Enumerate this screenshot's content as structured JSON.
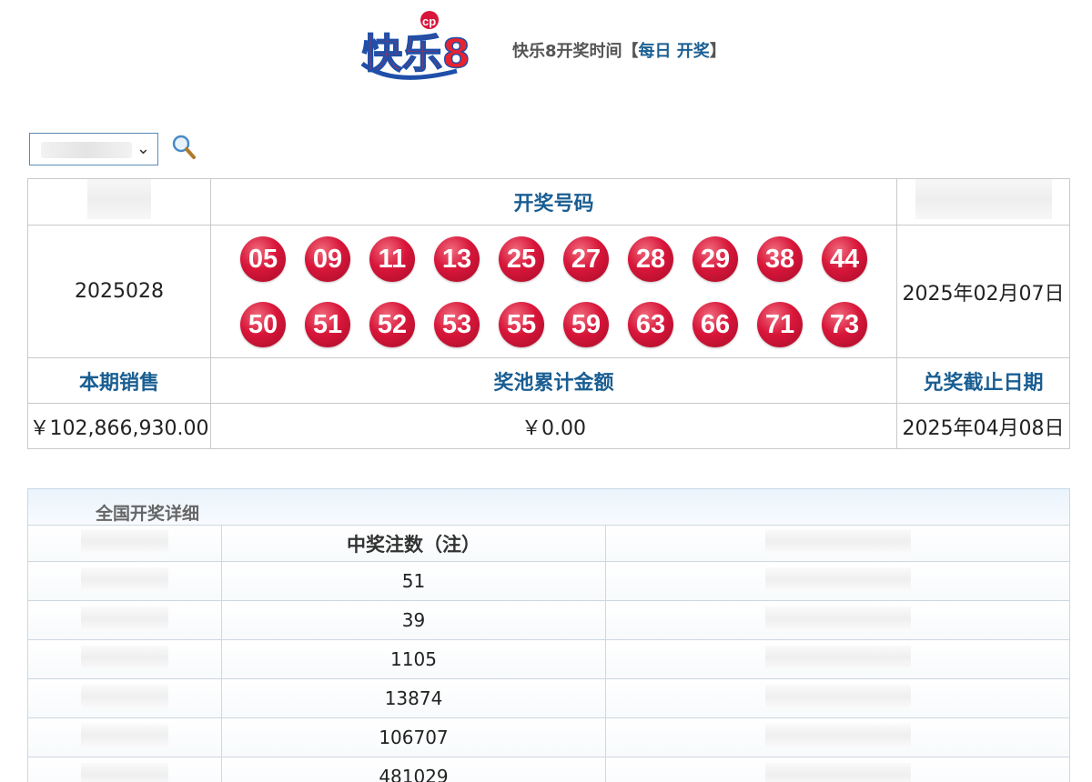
{
  "header": {
    "logo_text": "快乐8",
    "draw_time_label": "快乐8开奖时间【",
    "draw_time_value": "每日 开奖",
    "draw_time_close": "】"
  },
  "selector": {
    "search_icon": "magnifier-icon"
  },
  "results": {
    "draw_numbers_header": "开奖号码",
    "issue": "2025028",
    "numbers": [
      "05",
      "09",
      "11",
      "13",
      "25",
      "27",
      "28",
      "29",
      "38",
      "44",
      "50",
      "51",
      "52",
      "53",
      "55",
      "59",
      "63",
      "66",
      "71",
      "73"
    ],
    "draw_date": "2025年02月07日",
    "sales_header": "本期销售",
    "pool_header": "奖池累计金额",
    "deadline_header": "兑奖截止日期",
    "sales_value": "￥102,866,930.00",
    "pool_value": "￥0.00",
    "deadline_value": "2025年04月08日"
  },
  "details": {
    "caption": "全国开奖详细",
    "winners_header": "中奖注数（注）",
    "winner_counts": [
      "51",
      "39",
      "1105",
      "13874",
      "106707",
      "481029"
    ]
  },
  "colors": {
    "ball": "#d8163a",
    "header_text": "#1a5e92"
  }
}
